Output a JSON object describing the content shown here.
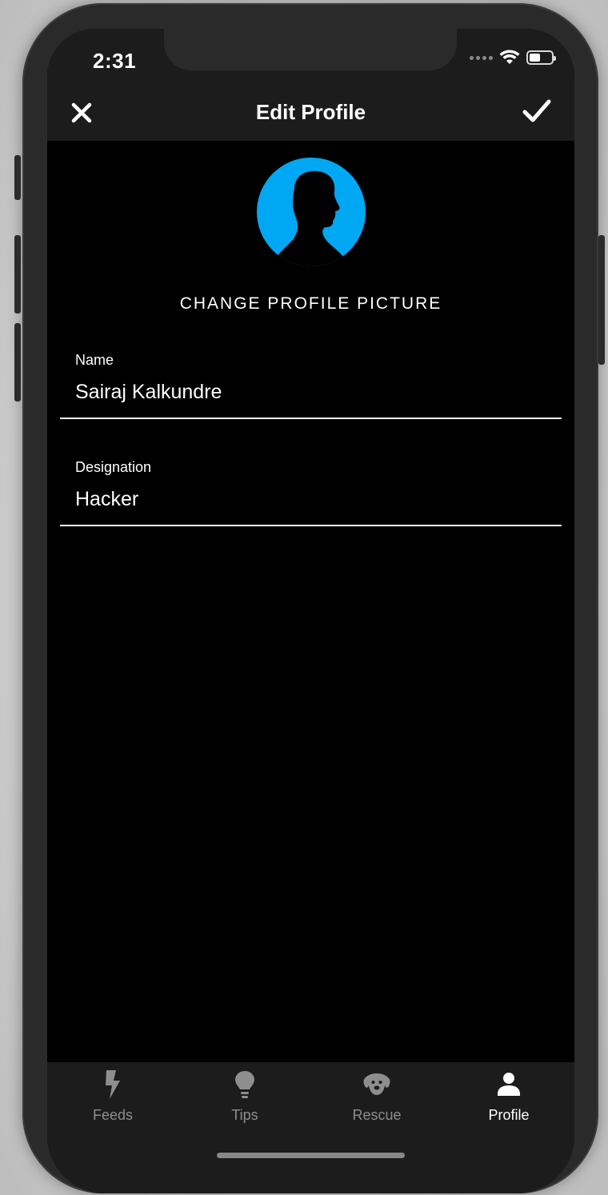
{
  "status_bar": {
    "time": "2:31",
    "battery_level": 0.5
  },
  "navbar": {
    "title": "Edit Profile",
    "close_icon": "close-icon",
    "save_icon": "checkmark-icon"
  },
  "profile": {
    "avatar_icon": "person-silhouette-icon",
    "avatar_color": "#00A8F3",
    "change_picture_label": "CHANGE PROFILE PICTURE"
  },
  "form": {
    "name": {
      "label": "Name",
      "value": "Sairaj Kalkundre"
    },
    "designation": {
      "label": "Designation",
      "value": "Hacker"
    }
  },
  "tabbar": {
    "active_color": "#FFFFFF",
    "inactive_color": "#8E8E8E",
    "items": [
      {
        "label": "Feeds",
        "icon": "lightning-icon",
        "active": false
      },
      {
        "label": "Tips",
        "icon": "lightbulb-icon",
        "active": false
      },
      {
        "label": "Rescue",
        "icon": "dog-icon",
        "active": false
      },
      {
        "label": "Profile",
        "icon": "user-icon",
        "active": true
      }
    ]
  }
}
